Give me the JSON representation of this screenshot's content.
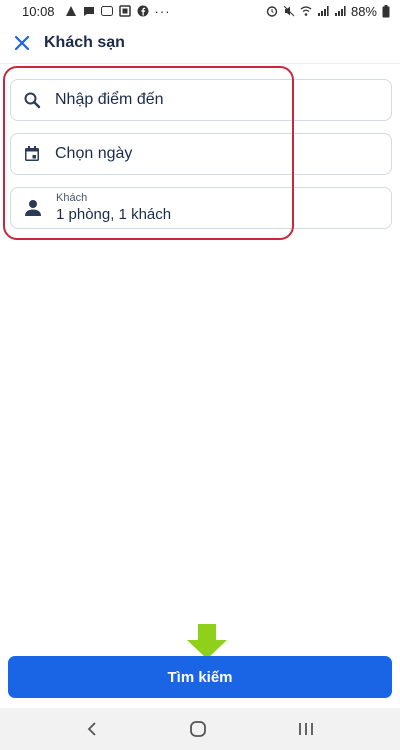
{
  "status_bar": {
    "time": "10:08",
    "battery": "88%"
  },
  "app_bar": {
    "title": "Khách sạn",
    "close_icon": "close-icon"
  },
  "form": {
    "destination": {
      "placeholder": "Nhập điểm đến",
      "icon": "search-icon"
    },
    "date": {
      "placeholder": "Chọn ngày",
      "icon": "calendar-icon"
    },
    "guests": {
      "label": "Khách",
      "value": "1 phòng, 1 khách",
      "icon": "person-icon"
    }
  },
  "search_button": {
    "label": "Tìm kiếm",
    "color": "#1a64e6"
  },
  "annotation": {
    "highlight_color": "#c8283c",
    "arrow_color": "#8fd11a"
  }
}
